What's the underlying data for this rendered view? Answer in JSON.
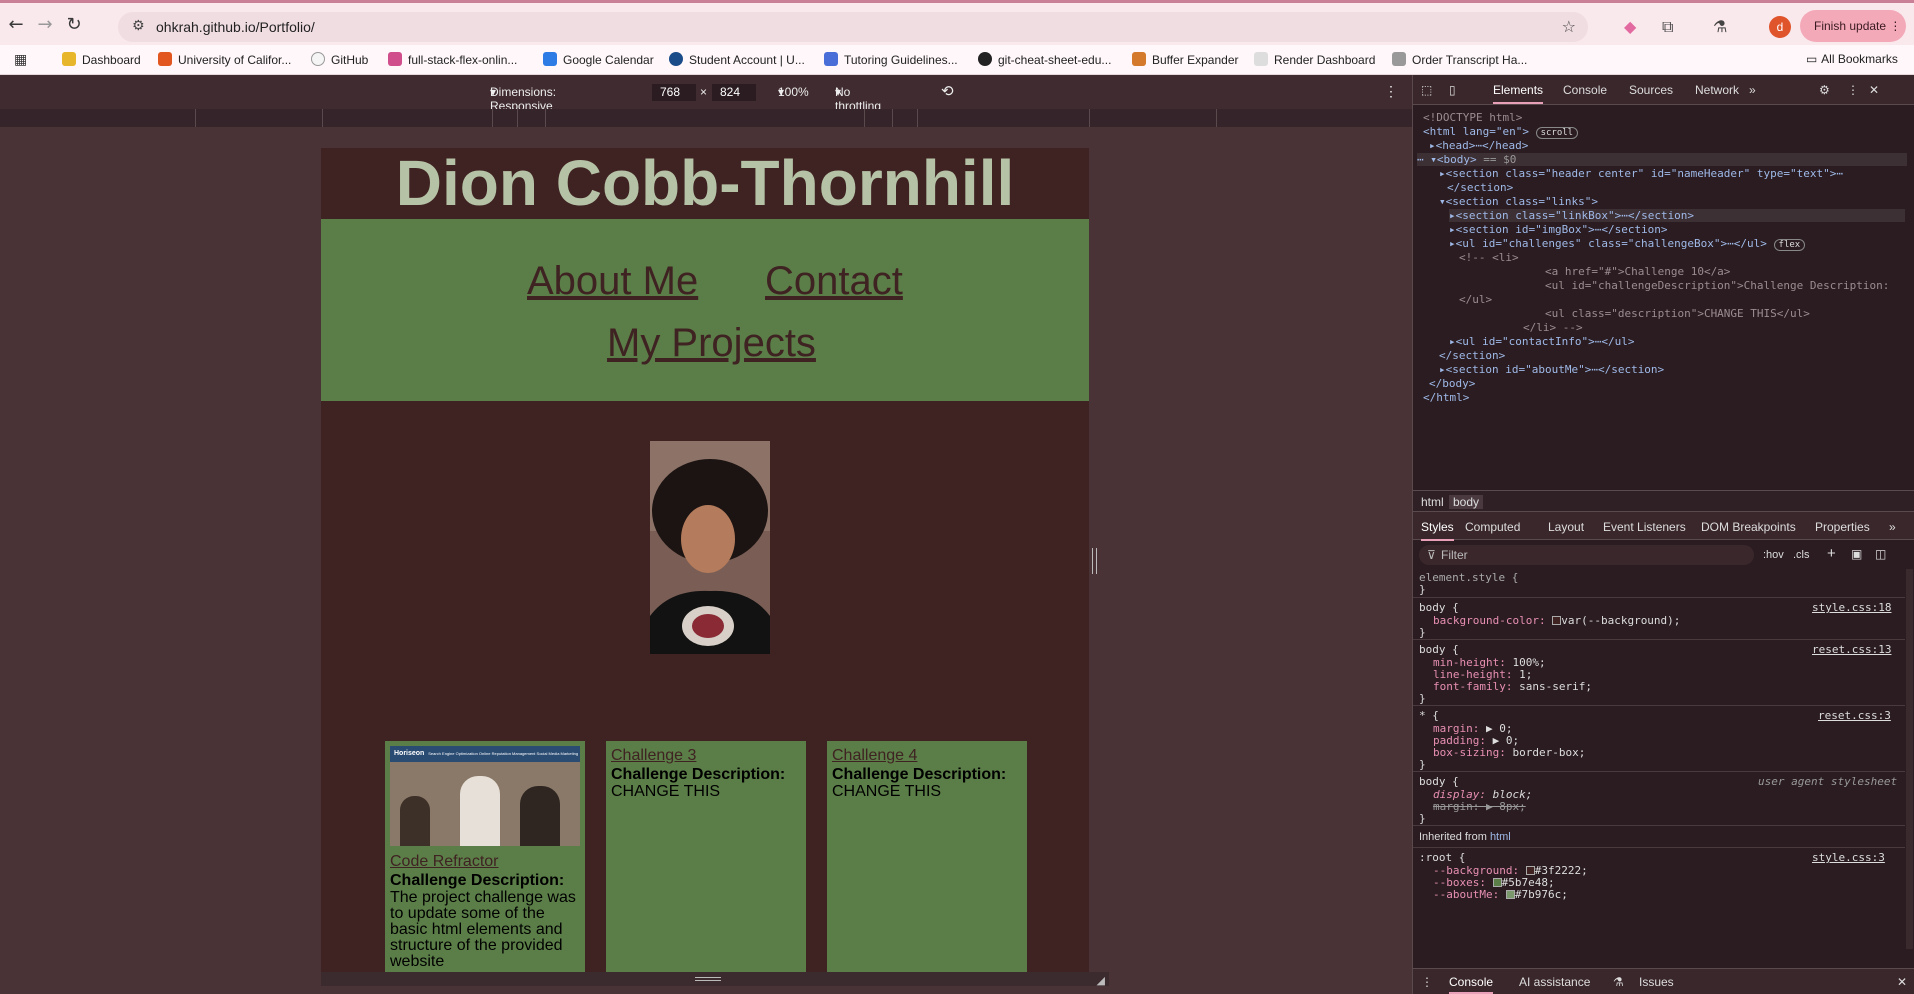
{
  "browser": {
    "url": "ohkrah.github.io/Portfolio/",
    "finish_update": "Finish update",
    "profile_initial": "d",
    "bookmarks": [
      "Dashboard",
      "University of Califor...",
      "GitHub",
      "full-stack-flex-onlin...",
      "Google Calendar",
      "Student Account | U...",
      "Tutoring Guidelines...",
      "git-cheat-sheet-edu...",
      "Buffer Expander",
      "Render Dashboard",
      "Order Transcript Ha..."
    ],
    "all_bookmarks": "All Bookmarks",
    "bookmark_colors": [
      "#3a63d8",
      "#e2561f",
      "#333333",
      "#d04e8c",
      "#2d7be5",
      "#1a4c8a",
      "#4a6ed8",
      "#222222",
      "#d47a2c",
      "#cccccc",
      "#888888"
    ]
  },
  "device_toolbar": {
    "dimensions_label": "Dimensions: Responsive",
    "width": "768",
    "height": "824",
    "x": "×",
    "zoom": "100%",
    "throttling": "No throttling"
  },
  "page": {
    "name": "Dion Cobb-Thornhill",
    "nav": {
      "about": "About Me",
      "contact": "Contact",
      "projects": "My Projects"
    },
    "challenges": [
      {
        "title": "Code Refractor",
        "desc_label": "Challenge Description:",
        "desc": "The project challenge was to update some of the basic html elements and structure of the provided website"
      },
      {
        "title": "Challenge 3",
        "desc_label": "Challenge Description:",
        "desc": "CHANGE THIS"
      },
      {
        "title": "Challenge 4",
        "desc_label": "Challenge Description:",
        "desc": "CHANGE THIS"
      }
    ],
    "screenshot_brand": "Horiseon",
    "screenshot_nav": "Search Engine Optimization    Online Reputation Management    Social Media Marketing"
  },
  "devtools": {
    "tabs": [
      "Elements",
      "Console",
      "Sources",
      "Network"
    ],
    "tree": {
      "doctype": "<!DOCTYPE html>",
      "html_open": "<html lang=\"en\">",
      "scroll_badge": "scroll",
      "head": "<head>",
      "head_close": "</head>",
      "body_open": "<body>",
      "body_sel": "== $0",
      "section_header": "<section class=\"header center\" id=\"nameHeader\" type=\"text\">",
      "section_close": "</section>",
      "section_links": "<section class=\"links\">",
      "linkbox": "<section class=\"linkBox\">",
      "imgbox": "<section id=\"imgBox\">",
      "challenges": "<ul id=\"challenges\" class=\"challengeBox\">",
      "ul_close": "</ul>",
      "flex_badge": "flex",
      "cmt1": "<!-- <li>",
      "cmt2": "<a href=\"#\">Challenge 10</a>",
      "cmt3": "<ul id=\"challengeDescription\">Challenge Description:",
      "cmt4": "</ul>",
      "cmt5": "<ul class=\"description\">CHANGE THIS</ul>",
      "cmt6": "</li> -->",
      "contactinfo": "<ul id=\"contactInfo\">",
      "section_close2": "</section>",
      "aboutme": "<section id=\"aboutMe\">",
      "body_close": "</body>",
      "html_close": "</html>",
      "ellipsis": "⋯"
    },
    "crumbs": [
      "html",
      "body"
    ],
    "style_tabs": [
      "Styles",
      "Computed",
      "Layout",
      "Event Listeners",
      "DOM Breakpoints",
      "Properties"
    ],
    "filter": "Filter",
    "hov": ":hov",
    "cls": ".cls",
    "styles": {
      "element_style": "element.style {",
      "close": "}",
      "body": "body {",
      "bg_prop": "background-color:",
      "bg_val": "var(--background);",
      "src1": "style.css:18",
      "minh_prop": "min-height:",
      "minh_val": "100%;",
      "lh_prop": "line-height:",
      "lh_val": "1;",
      "ff_prop": "font-family:",
      "ff_val": "sans-serif;",
      "src2": "reset.css:13",
      "star": "* {",
      "margin_prop": "margin:",
      "margin_val": "▶ 0;",
      "padding_prop": "padding:",
      "padding_val": "▶ 0;",
      "bs_prop": "box-sizing:",
      "bs_val": "border-box;",
      "src3": "reset.css:3",
      "ua": "user agent stylesheet",
      "disp_prop": "display:",
      "disp_val": "block;",
      "ua_margin": "margin: ▶ 8px;",
      "inherited": "Inherited from",
      "inherited_el": "html",
      "root": ":root {",
      "src4": "style.css:3",
      "v1_prop": "--background:",
      "v1_val": "#3f2222;",
      "v2_prop": "--boxes:",
      "v2_val": "#5b7e48;",
      "v3_prop": "--aboutMe:",
      "v3_val": "#7b976c;"
    },
    "drawer": [
      "Console",
      "AI assistance",
      "Issues"
    ]
  }
}
